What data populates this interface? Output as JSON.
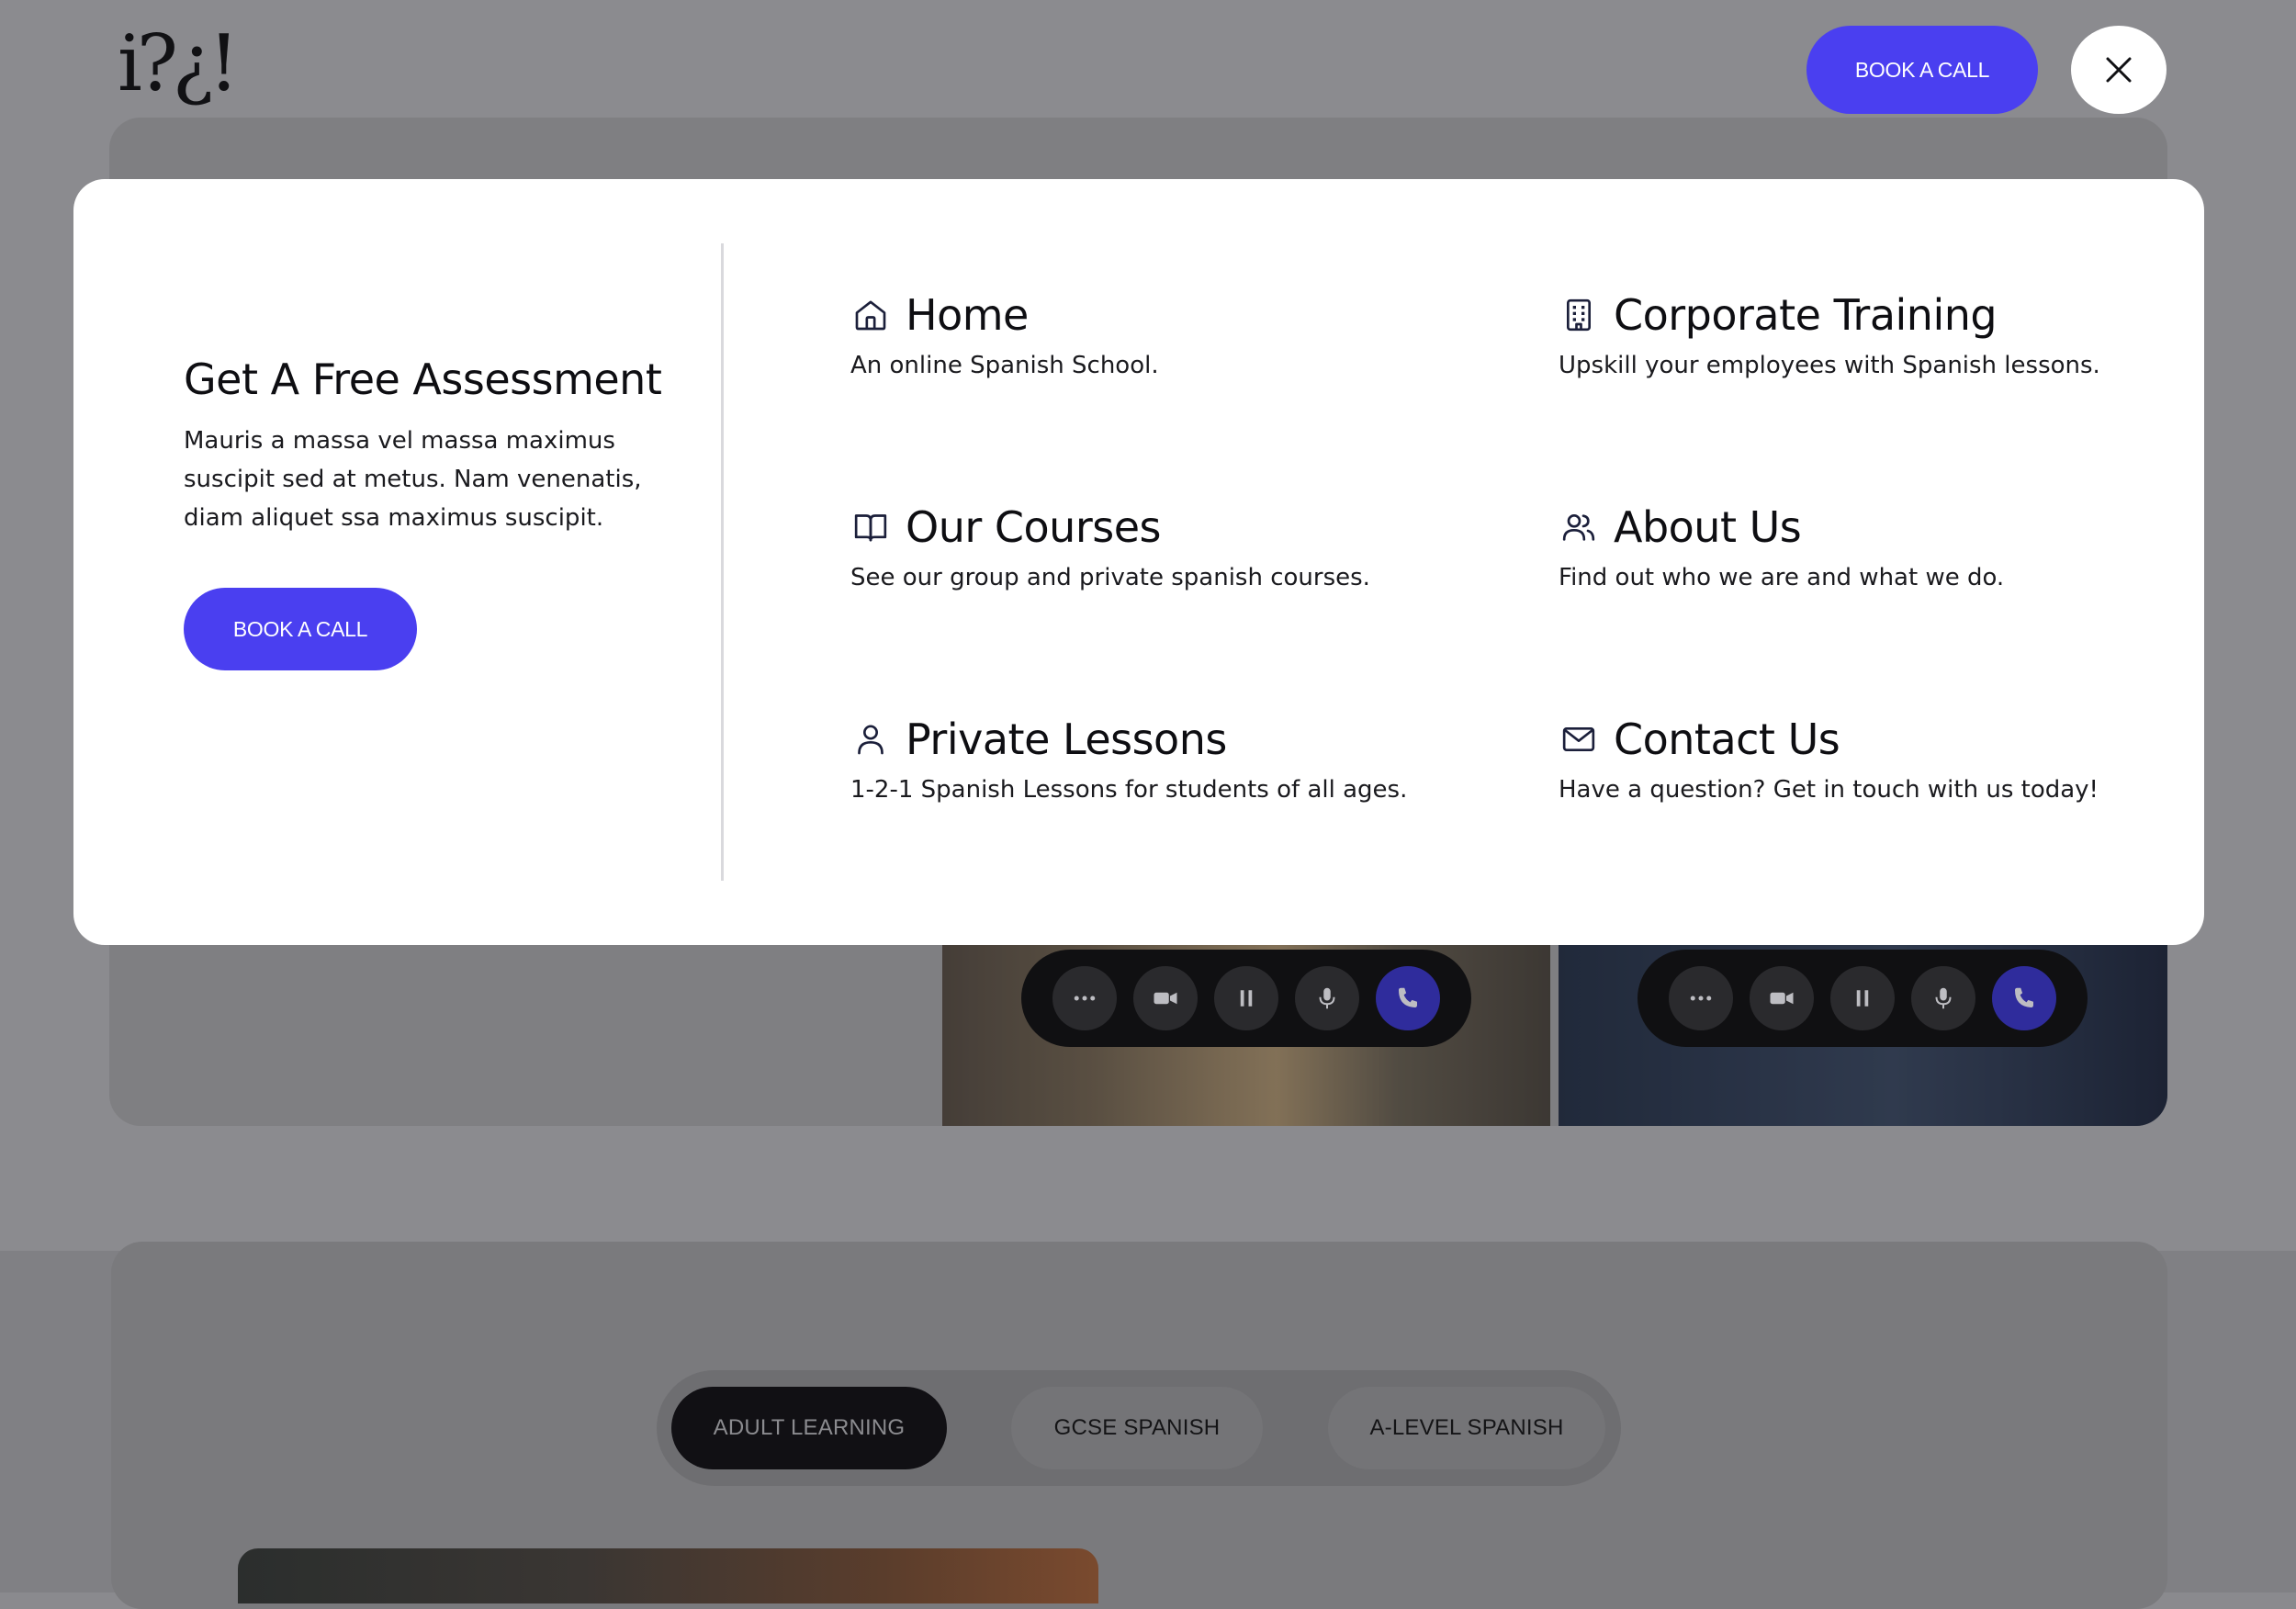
{
  "header": {
    "logo_text": "i?¿!",
    "book_call_label": "BOOK A CALL",
    "close_icon": "close-icon"
  },
  "promo": {
    "title": "Get A Free Assessment",
    "text": "Mauris a massa vel massa maximus suscipit sed at metus. Nam venenatis, diam aliquet ssa maximus suscipit.",
    "button_label": "BOOK A CALL"
  },
  "nav": [
    {
      "title": "Home",
      "desc": "An online Spanish School.",
      "icon": "home-icon"
    },
    {
      "title": "Corporate Training",
      "desc": "Upskill your employees with Spanish lessons.",
      "icon": "building-icon"
    },
    {
      "title": "Our Courses",
      "desc": "See our group and private spanish courses.",
      "icon": "book-icon"
    },
    {
      "title": "About Us",
      "desc": "Find out who we are and what we do.",
      "icon": "users-icon"
    },
    {
      "title": "Private Lessons",
      "desc": "1-2-1 Spanish Lessons for students of all ages.",
      "icon": "user-icon"
    },
    {
      "title": "Contact Us",
      "desc": "Have a question? Get in touch with us today!",
      "icon": "mail-icon"
    }
  ],
  "tabs": [
    {
      "label": "ADULT LEARNING",
      "active": true
    },
    {
      "label": "GCSE SPANISH",
      "active": false
    },
    {
      "label": "A-LEVEL SPANISH",
      "active": false
    }
  ],
  "colors": {
    "accent": "#4a3ff0",
    "overlay": "#8a8a8e",
    "panel": "#ffffff",
    "text": "#0e0e12"
  }
}
